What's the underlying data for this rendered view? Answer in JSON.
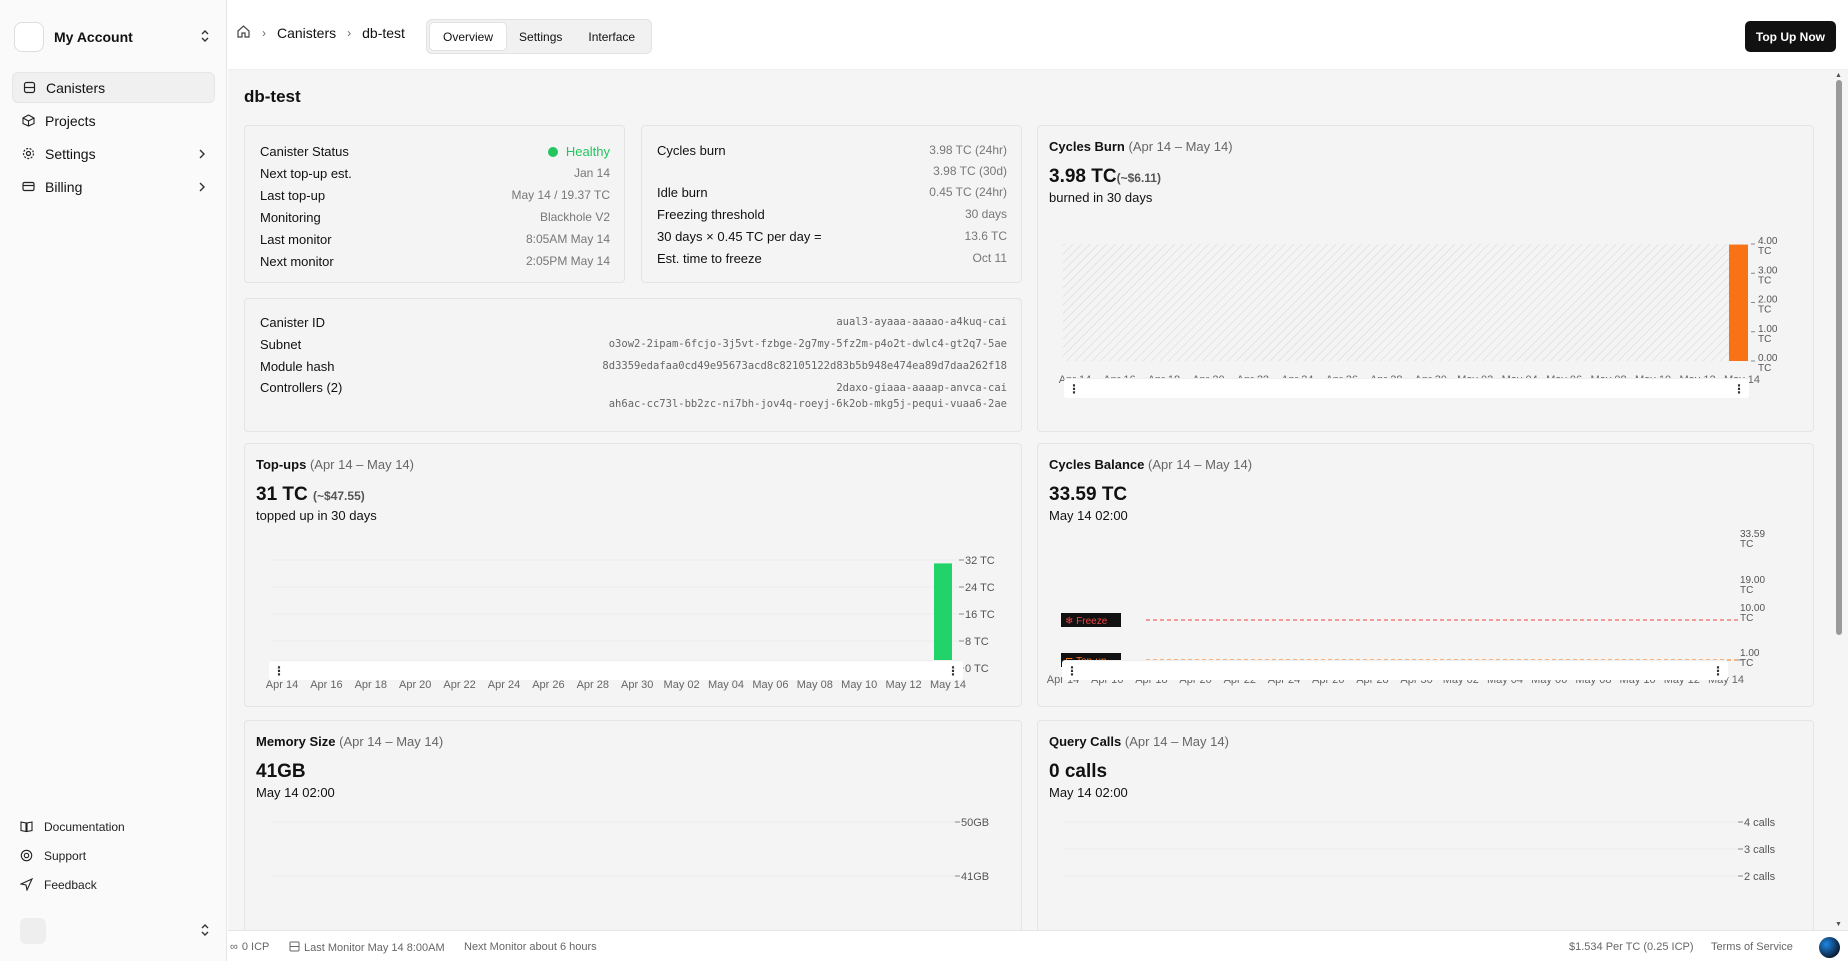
{
  "account": {
    "name": "My Account"
  },
  "nav": [
    {
      "label": "Canisters"
    },
    {
      "label": "Projects"
    },
    {
      "label": "Settings"
    },
    {
      "label": "Billing"
    }
  ],
  "footer_nav": [
    {
      "label": "Documentation"
    },
    {
      "label": "Support"
    },
    {
      "label": "Feedback"
    }
  ],
  "header": {
    "breadcrumb": [
      "Canisters",
      "db-test"
    ],
    "tabs": [
      "Overview",
      "Settings",
      "Interface"
    ],
    "topup_button": "Top Up Now"
  },
  "page_title": "db-test",
  "status_card": [
    {
      "label": "Canister Status",
      "value": "Healthy"
    },
    {
      "label": "Next top-up est.",
      "value": "Jan 14"
    },
    {
      "label": "Last top-up",
      "value": "May 14 / 19.37 TC"
    },
    {
      "label": "Monitoring",
      "value": "Blackhole V2"
    },
    {
      "label": "Last monitor",
      "value": "8:05AM May 14"
    },
    {
      "label": "Next monitor",
      "value": "2:05PM May 14"
    }
  ],
  "burn_card": [
    {
      "label": "Cycles burn",
      "value": "3.98 TC  (24hr)"
    },
    {
      "label": "",
      "value": "3.98 TC  (30d)"
    },
    {
      "label": "Idle burn",
      "value": "0.45 TC  (24hr)"
    },
    {
      "label": "Freezing threshold",
      "value": "30 days"
    },
    {
      "label": "30 days × 0.45 TC per day =",
      "value": "13.6 TC"
    },
    {
      "label": "Est. time to freeze",
      "value": "Oct 11"
    }
  ],
  "ids_card": {
    "canister_id_label": "Canister ID",
    "canister_id": "aual3-ayaaa-aaaao-a4kuq-cai",
    "subnet_label": "Subnet",
    "subnet": "o3ow2-2ipam-6fcjo-3j5vt-fzbge-2g7my-5fz2m-p4o2t-dwlc4-gt2q7-5ae",
    "module_hash_label": "Module hash",
    "module_hash": "8d3359edafaa0cd49e95673acd8c82105122d83b5b948e474ea89d7daa262f18",
    "controllers_label": "Controllers (2)",
    "controllers": [
      "2daxo-giaaa-aaaap-anvca-cai",
      "ah6ac-cc73l-bb2zc-ni7bh-jov4q-roeyj-6k2ob-mkg5j-pequi-vuaa6-2ae"
    ]
  },
  "cards": {
    "cycles_burn": {
      "title": "Cycles Burn",
      "range": "(Apr 14 – May 14)",
      "big": "3.98 TC",
      "sub": "(~$6.11)",
      "caption": "burned in 30 days"
    },
    "topups": {
      "title": "Top-ups",
      "range": "(Apr 14 – May 14)",
      "big": "31 TC",
      "sub": "(~$47.55)",
      "caption": "topped up in 30 days"
    },
    "balance": {
      "title": "Cycles Balance",
      "range": "(Apr 14 – May 14)",
      "big": "33.59 TC",
      "caption": "May 14 02:00"
    },
    "memory": {
      "title": "Memory Size",
      "range": "(Apr 14 – May 14)",
      "big": "41GB",
      "caption": "May 14 02:00"
    },
    "query": {
      "title": "Query Calls",
      "range": "(Apr 14 – May 14)",
      "big": "0 calls",
      "caption": "May 14 02:00"
    }
  },
  "chart_data": [
    {
      "type": "bar",
      "title": "Cycles Burn",
      "x": [
        "Apr 14",
        "Apr 16",
        "Apr 18",
        "Apr 20",
        "Apr 22",
        "Apr 24",
        "Apr 26",
        "Apr 28",
        "Apr 30",
        "May 02",
        "May 04",
        "May 06",
        "May 08",
        "May 10",
        "May 12",
        "May 14"
      ],
      "values": [
        0,
        0,
        0,
        0,
        0,
        0,
        0,
        0,
        0,
        0,
        0,
        0,
        0,
        0,
        0,
        3.98
      ],
      "yticks": [
        "4.00 TC",
        "3.00 TC",
        "2.00 TC",
        "1.00 TC",
        "0.00 TC"
      ],
      "ylim": [
        0,
        4
      ],
      "bar_color": "#f97316"
    },
    {
      "type": "bar",
      "title": "Top-ups",
      "x": [
        "Apr 14",
        "Apr 16",
        "Apr 18",
        "Apr 20",
        "Apr 22",
        "Apr 24",
        "Apr 26",
        "Apr 28",
        "Apr 30",
        "May 02",
        "May 04",
        "May 06",
        "May 08",
        "May 10",
        "May 12",
        "May 14"
      ],
      "values": [
        0,
        0,
        0,
        0,
        0,
        0,
        0,
        0,
        0,
        0,
        0,
        0,
        0,
        0,
        0,
        31
      ],
      "yticks": [
        "32 TC",
        "24 TC",
        "16 TC",
        "8 TC",
        "0 TC"
      ],
      "ylim": [
        0,
        32
      ],
      "bar_color": "#22d36a"
    },
    {
      "type": "line",
      "title": "Cycles Balance",
      "x": [
        "Apr 14",
        "Apr 16",
        "Apr 18",
        "Apr 20",
        "Apr 22",
        "Apr 24",
        "Apr 26",
        "Apr 28",
        "Apr 30",
        "May 02",
        "May 04",
        "May 06",
        "May 08",
        "May 10",
        "May 12",
        "May 14"
      ],
      "yticks": [
        "33.59 TC",
        "19.00 TC",
        "10.00 TC",
        "1.00 TC"
      ],
      "markers": [
        {
          "label": "Freeze"
        },
        {
          "label": "Top-up"
        }
      ]
    },
    {
      "type": "line",
      "title": "Memory Size",
      "yticks": [
        "50GB",
        "41GB"
      ]
    },
    {
      "type": "line",
      "title": "Query Calls",
      "yticks": [
        "4 calls",
        "3 calls",
        "2 calls"
      ]
    }
  ],
  "status_bar": {
    "icp": "0 ICP",
    "last_monitor": "Last Monitor May 14 8:00AM",
    "next_monitor": "Next Monitor about 6 hours",
    "price": "$1.534 Per TC (0.25 ICP)",
    "terms": "Terms of Service"
  },
  "colors": {
    "accent_green": "#22c55e",
    "burn_orange": "#f97316",
    "topup_green": "#22d36a",
    "marker_red": "#ef4444"
  }
}
